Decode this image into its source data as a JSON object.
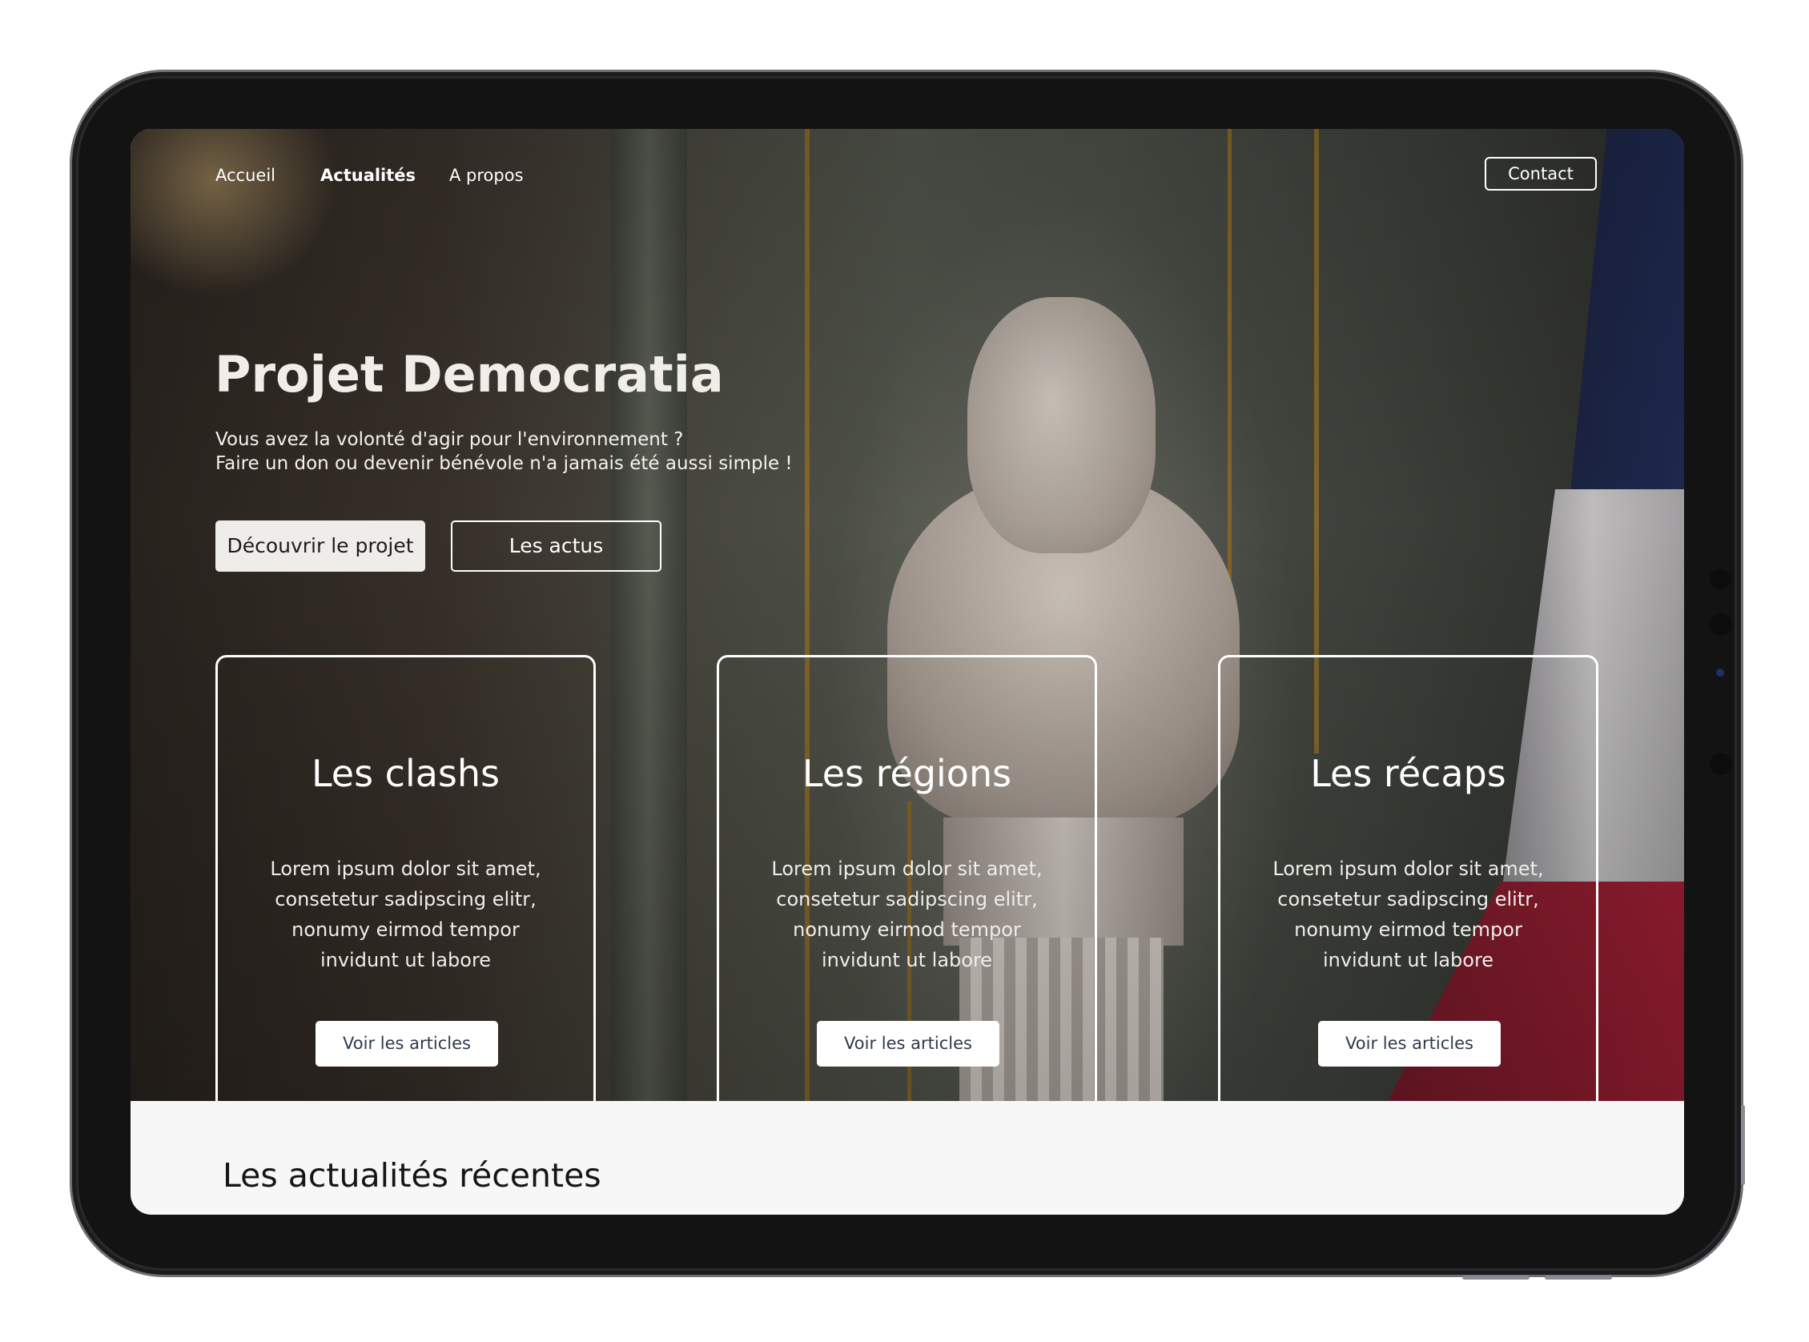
{
  "nav": {
    "links": [
      "Accueil",
      "Actualités",
      "A propos"
    ],
    "active": "Actualités",
    "contact_label": "Contact"
  },
  "hero": {
    "title": "Projet Democratia",
    "subtitle_line1": "Vous avez la volonté d'agir pour l'environnement ?",
    "subtitle_line2": "Faire un don ou devenir bénévole n'a jamais été aussi simple !",
    "primary_button": "Découvrir le projet",
    "secondary_button": "Les actus"
  },
  "cards": [
    {
      "title": "Les clashs",
      "text": "Lorem ipsum dolor sit amet, consetetur sadipscing elitr, nonumy eirmod tempor invidunt ut labore",
      "button": "Voir les articles"
    },
    {
      "title": "Les régions",
      "text": "Lorem ipsum dolor sit amet, consetetur sadipscing elitr, nonumy eirmod tempor invidunt ut labore",
      "button": "Voir les articles"
    },
    {
      "title": "Les récaps",
      "text": "Lorem ipsum dolor sit amet, consetetur sadipscing elitr, nonumy eirmod tempor invidunt ut labore",
      "button": "Voir les articles"
    }
  ],
  "recent": {
    "title": "Les actualités récentes"
  },
  "colors": {
    "device_frame": "#131313",
    "button_light": "#efedea",
    "section_background": "#f7f7f7",
    "flag_blue": "#202a52",
    "flag_red": "#a31f35"
  }
}
